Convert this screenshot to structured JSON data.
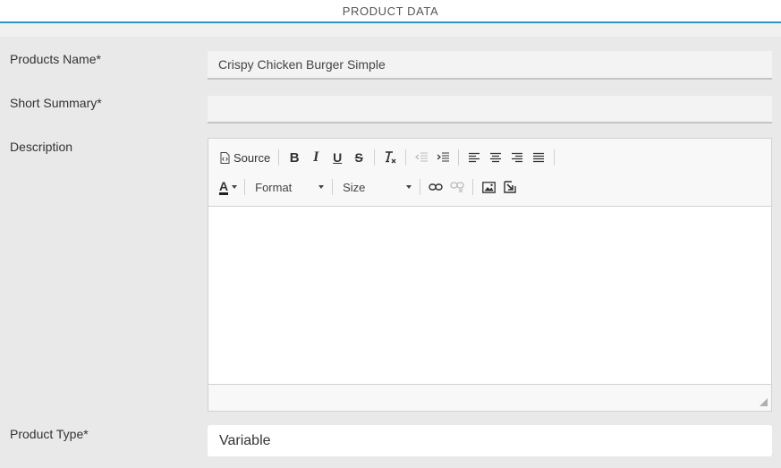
{
  "header": {
    "title": "PRODUCT DATA"
  },
  "form": {
    "product_name": {
      "label": "Products Name*",
      "value": "Crispy Chicken Burger Simple"
    },
    "short_summary": {
      "label": "Short Summary*",
      "value": ""
    },
    "description": {
      "label": "Description",
      "toolbar": {
        "source_label": "Source",
        "bold": "B",
        "italic": "I",
        "underline": "U",
        "strike": "S",
        "text_color": "A",
        "format_label": "Format",
        "size_label": "Size"
      },
      "content": ""
    },
    "product_type": {
      "label": "Product Type*",
      "value": "Variable"
    }
  },
  "colors": {
    "accent": "#2e94c9",
    "background": "#e9e9ea"
  }
}
